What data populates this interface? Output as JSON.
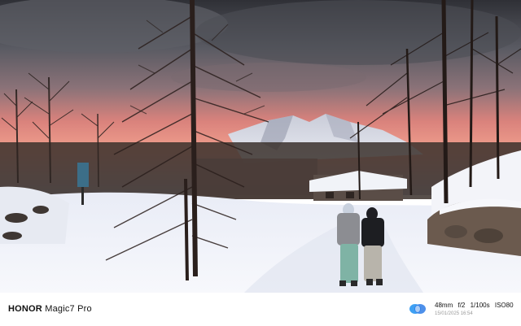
{
  "watermark": {
    "brand": "HONOR",
    "model": "Magic7 Pro",
    "focal_length": "48mm",
    "aperture": "f/2",
    "shutter": "1/100s",
    "iso": "ISO80",
    "datetime": "15/01/2025 16:54",
    "logo_icon": "honor-logo-icon"
  },
  "photo": {
    "subject": "snowy-mountain-path-at-dusk",
    "colors": {
      "sky_top": "#3a3c44",
      "sky_glow": "#f07a6a",
      "snow": "#f4f6fb",
      "trees": "#2a1f1c"
    }
  }
}
